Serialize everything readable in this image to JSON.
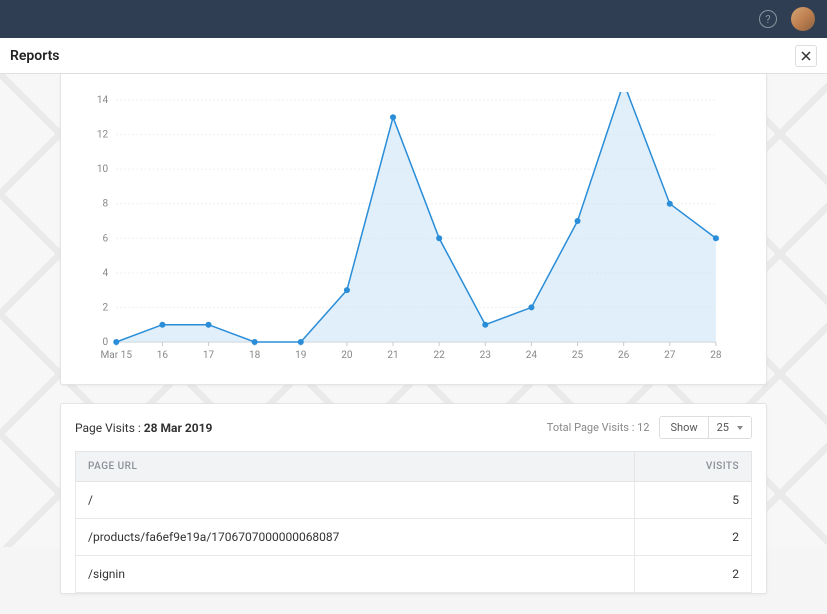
{
  "topbar": {
    "help_glyph": "?"
  },
  "title": "Reports",
  "chart_data": {
    "type": "area",
    "categories": [
      "Mar 15",
      "16",
      "17",
      "18",
      "19",
      "20",
      "21",
      "22",
      "23",
      "24",
      "25",
      "26",
      "27",
      "28"
    ],
    "values": [
      0,
      1,
      1,
      0,
      0,
      3,
      13,
      6,
      1,
      2,
      7,
      15,
      8,
      6
    ],
    "xlabel": "",
    "ylabel": "",
    "ylim": [
      0,
      14
    ],
    "yticks": [
      0,
      2,
      4,
      6,
      8,
      10,
      12,
      14
    ]
  },
  "visits": {
    "label": "Page Visits :",
    "date": "28 Mar 2019",
    "total_label": "Total Page Visits :",
    "total_value": "12",
    "show_label": "Show",
    "page_size": "25",
    "columns": {
      "url": "PAGE URL",
      "visits": "VISITS"
    },
    "rows": [
      {
        "url": "/",
        "visits": 5
      },
      {
        "url": "/products/fa6ef9e19a/1706707000000068087",
        "visits": 2
      },
      {
        "url": "/signin",
        "visits": 2
      }
    ]
  }
}
